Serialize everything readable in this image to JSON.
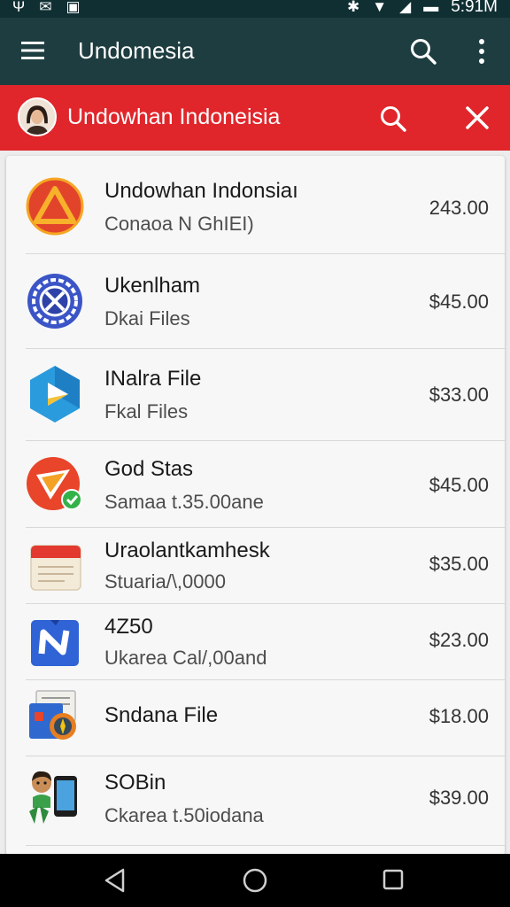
{
  "status_bar": {
    "time": "5:91M"
  },
  "app_bar": {
    "title": "Undomesia"
  },
  "search": {
    "query": "Undowhan Indoneisia"
  },
  "items": [
    {
      "title": "Undowhan Indonsiaı",
      "subtitle": "Conaoa N GhIEI)",
      "price": "243.00",
      "icon": "triangle-app-icon"
    },
    {
      "title": "Ukenlham",
      "subtitle": "Dkai Files",
      "price": "$45.00",
      "icon": "gear-x-app-icon"
    },
    {
      "title": "INalra File",
      "subtitle": "Fkal Files",
      "price": "$33.00",
      "icon": "play-app-icon"
    },
    {
      "title": "God Stas",
      "subtitle": "Samaa t.35.00ane",
      "price": "$45.00",
      "icon": "red-check-app-icon"
    },
    {
      "title": "Uraolantkamhesk",
      "subtitle": "Stuaria/\\,0000",
      "price": "$35.00",
      "icon": "calendar-app-icon"
    },
    {
      "title": "4Z50",
      "subtitle": "Ukarea Cal/,00and",
      "price": "$23.00",
      "icon": "n-logo-app-icon"
    },
    {
      "title": "Sndana File",
      "subtitle": "",
      "price": "$18.00",
      "icon": "compass-files-app-icon"
    },
    {
      "title": "SOBin",
      "subtitle": "Ckarea t.50iodana",
      "price": "$39.00",
      "icon": "phone-person-app-icon"
    }
  ],
  "colors": {
    "app_bar": "#1e3d40",
    "search_bar": "#e0262b",
    "status_bar": "#102f33"
  }
}
